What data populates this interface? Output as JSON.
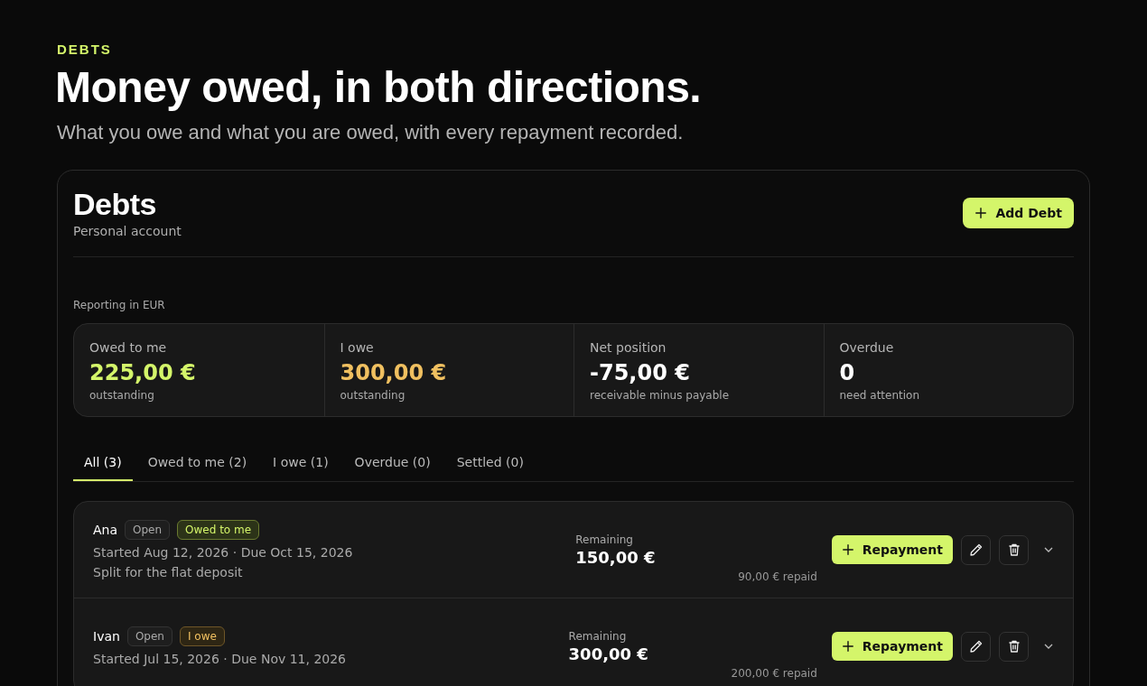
{
  "eyebrow": "DEBTS",
  "headline": "Money owed, in both directions.",
  "subtitle": "What you owe and what you are owed, with every repayment recorded.",
  "card": {
    "title": "Debts",
    "account": "Personal account",
    "add_button": "Add Debt",
    "reporting": "Reporting in EUR",
    "stats": [
      {
        "label": "Owed to me",
        "value": "225,00 €",
        "note": "outstanding",
        "kind": "positive"
      },
      {
        "label": "I owe",
        "value": "300,00 €",
        "note": "outstanding",
        "kind": "negative"
      },
      {
        "label": "Net position",
        "value": "-75,00 €",
        "note": "receivable minus payable",
        "kind": "neutral"
      },
      {
        "label": "Overdue",
        "value": "0",
        "note": "need attention",
        "kind": "neutral"
      }
    ],
    "tabs": [
      {
        "label": "All (3)",
        "selected": true
      },
      {
        "label": "Owed to me (2)",
        "selected": false
      },
      {
        "label": "I owe (1)",
        "selected": false
      },
      {
        "label": "Overdue (0)",
        "selected": false
      },
      {
        "label": "Settled (0)",
        "selected": false
      }
    ],
    "debts": [
      {
        "name": "Ana",
        "status": "Open",
        "direction": {
          "label": "Owed to me",
          "kind": "owed"
        },
        "dates": "Started Aug 12, 2026 · Due Oct 15, 2026",
        "note": "Split for the flat deposit",
        "remaining_label": "Remaining",
        "remaining": "150,00 €",
        "repaid": "90,00 € repaid",
        "repay_button": "Repayment"
      },
      {
        "name": "Ivan",
        "status": "Open",
        "direction": {
          "label": "I owe",
          "kind": "owe"
        },
        "dates": "Started Jul 15, 2026 · Due Nov 11, 2026",
        "remaining_label": "Remaining",
        "remaining": "300,00 €",
        "repaid": "200,00 € repaid",
        "repay_button": "Repayment"
      }
    ]
  }
}
